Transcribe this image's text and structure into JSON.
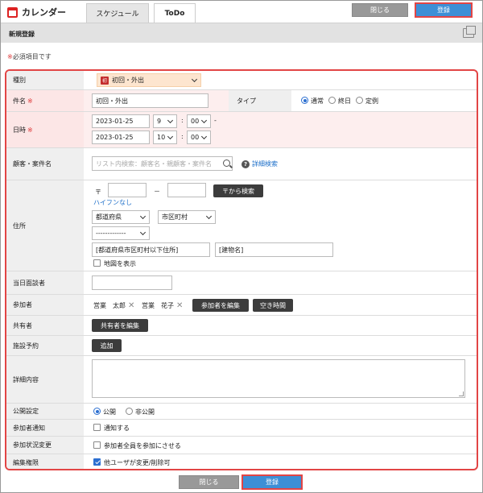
{
  "header": {
    "app_title": "カレンダー",
    "tabs": [
      {
        "label": "スケジュール"
      },
      {
        "label": "ToDo"
      }
    ],
    "close_label": "閉じる",
    "submit_label": "登録"
  },
  "section": {
    "title": "新規登録"
  },
  "required_note": {
    "mark": "※",
    "text": "必須項目です"
  },
  "form": {
    "category": {
      "label": "種別",
      "icon_text": "初",
      "value": "初回・外出"
    },
    "subject": {
      "label": "件名",
      "required_mark": "※",
      "value": "初回・外出",
      "type_label": "タイプ",
      "type_options": [
        "通常",
        "終日",
        "定例"
      ],
      "type_selected": "通常"
    },
    "datetime": {
      "label": "日時",
      "required_mark": "※",
      "start_date": "2023-01-25",
      "start_hour": "9",
      "start_min": "00",
      "sep": ":",
      "dash": "-",
      "end_date": "2023-01-25",
      "end_hour": "10",
      "end_min": "00"
    },
    "customer": {
      "label": "顧客・案件名",
      "placeholder": "リスト内検索：顧客名・親顧客・案件名",
      "detail_search": "詳細検索"
    },
    "address": {
      "label": "住所",
      "postal_mark": "〒",
      "postal_dash": "－",
      "postal_search": "〒から検索",
      "hyphen_note": "ハイフンなし",
      "prefecture": "都道府県",
      "city": "市区町村",
      "district": "-------------",
      "street_ph": "[都道府県市区町村以下住所]",
      "building_ph": "[建物名]",
      "show_map": "地図を表示"
    },
    "contact": {
      "label": "当日面談者"
    },
    "participants": {
      "label": "参加者",
      "names": [
        "営業　太郎",
        "営業　花子"
      ],
      "edit": "参加者を編集",
      "free_time": "空き時間"
    },
    "sharers": {
      "label": "共有者",
      "edit": "共有者を編集"
    },
    "facility": {
      "label": "施設予約",
      "add": "追加"
    },
    "details": {
      "label": "詳細内容"
    },
    "visibility": {
      "label": "公開設定",
      "options": [
        "公開",
        "非公開"
      ],
      "selected": "公開"
    },
    "notify": {
      "label": "参加者通知",
      "option": "通知する",
      "checked": false
    },
    "status_change": {
      "label": "参加状況変更",
      "option": "参加者全員を参加にさせる",
      "checked": false
    },
    "edit_perm": {
      "label": "編集権限",
      "option": "他ユーザが変更/削除可",
      "checked": true
    }
  },
  "footer": {
    "close_label": "閉じる",
    "submit_label": "登録"
  }
}
